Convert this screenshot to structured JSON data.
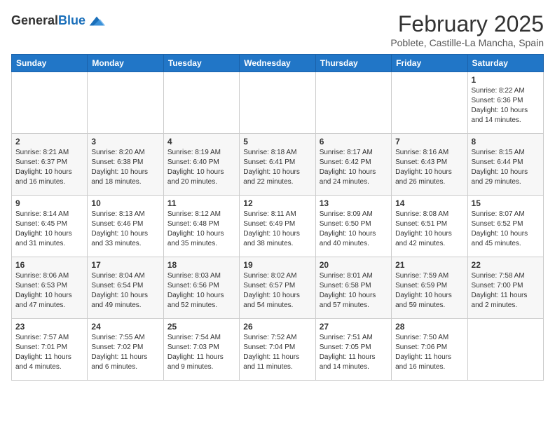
{
  "header": {
    "logo_general": "General",
    "logo_blue": "Blue",
    "title": "February 2025",
    "subtitle": "Poblete, Castille-La Mancha, Spain"
  },
  "weekdays": [
    "Sunday",
    "Monday",
    "Tuesday",
    "Wednesday",
    "Thursday",
    "Friday",
    "Saturday"
  ],
  "weeks": [
    [
      {
        "day": "",
        "info": ""
      },
      {
        "day": "",
        "info": ""
      },
      {
        "day": "",
        "info": ""
      },
      {
        "day": "",
        "info": ""
      },
      {
        "day": "",
        "info": ""
      },
      {
        "day": "",
        "info": ""
      },
      {
        "day": "1",
        "info": "Sunrise: 8:22 AM\nSunset: 6:36 PM\nDaylight: 10 hours and 14 minutes."
      }
    ],
    [
      {
        "day": "2",
        "info": "Sunrise: 8:21 AM\nSunset: 6:37 PM\nDaylight: 10 hours and 16 minutes."
      },
      {
        "day": "3",
        "info": "Sunrise: 8:20 AM\nSunset: 6:38 PM\nDaylight: 10 hours and 18 minutes."
      },
      {
        "day": "4",
        "info": "Sunrise: 8:19 AM\nSunset: 6:40 PM\nDaylight: 10 hours and 20 minutes."
      },
      {
        "day": "5",
        "info": "Sunrise: 8:18 AM\nSunset: 6:41 PM\nDaylight: 10 hours and 22 minutes."
      },
      {
        "day": "6",
        "info": "Sunrise: 8:17 AM\nSunset: 6:42 PM\nDaylight: 10 hours and 24 minutes."
      },
      {
        "day": "7",
        "info": "Sunrise: 8:16 AM\nSunset: 6:43 PM\nDaylight: 10 hours and 26 minutes."
      },
      {
        "day": "8",
        "info": "Sunrise: 8:15 AM\nSunset: 6:44 PM\nDaylight: 10 hours and 29 minutes."
      }
    ],
    [
      {
        "day": "9",
        "info": "Sunrise: 8:14 AM\nSunset: 6:45 PM\nDaylight: 10 hours and 31 minutes."
      },
      {
        "day": "10",
        "info": "Sunrise: 8:13 AM\nSunset: 6:46 PM\nDaylight: 10 hours and 33 minutes."
      },
      {
        "day": "11",
        "info": "Sunrise: 8:12 AM\nSunset: 6:48 PM\nDaylight: 10 hours and 35 minutes."
      },
      {
        "day": "12",
        "info": "Sunrise: 8:11 AM\nSunset: 6:49 PM\nDaylight: 10 hours and 38 minutes."
      },
      {
        "day": "13",
        "info": "Sunrise: 8:09 AM\nSunset: 6:50 PM\nDaylight: 10 hours and 40 minutes."
      },
      {
        "day": "14",
        "info": "Sunrise: 8:08 AM\nSunset: 6:51 PM\nDaylight: 10 hours and 42 minutes."
      },
      {
        "day": "15",
        "info": "Sunrise: 8:07 AM\nSunset: 6:52 PM\nDaylight: 10 hours and 45 minutes."
      }
    ],
    [
      {
        "day": "16",
        "info": "Sunrise: 8:06 AM\nSunset: 6:53 PM\nDaylight: 10 hours and 47 minutes."
      },
      {
        "day": "17",
        "info": "Sunrise: 8:04 AM\nSunset: 6:54 PM\nDaylight: 10 hours and 49 minutes."
      },
      {
        "day": "18",
        "info": "Sunrise: 8:03 AM\nSunset: 6:56 PM\nDaylight: 10 hours and 52 minutes."
      },
      {
        "day": "19",
        "info": "Sunrise: 8:02 AM\nSunset: 6:57 PM\nDaylight: 10 hours and 54 minutes."
      },
      {
        "day": "20",
        "info": "Sunrise: 8:01 AM\nSunset: 6:58 PM\nDaylight: 10 hours and 57 minutes."
      },
      {
        "day": "21",
        "info": "Sunrise: 7:59 AM\nSunset: 6:59 PM\nDaylight: 10 hours and 59 minutes."
      },
      {
        "day": "22",
        "info": "Sunrise: 7:58 AM\nSunset: 7:00 PM\nDaylight: 11 hours and 2 minutes."
      }
    ],
    [
      {
        "day": "23",
        "info": "Sunrise: 7:57 AM\nSunset: 7:01 PM\nDaylight: 11 hours and 4 minutes."
      },
      {
        "day": "24",
        "info": "Sunrise: 7:55 AM\nSunset: 7:02 PM\nDaylight: 11 hours and 6 minutes."
      },
      {
        "day": "25",
        "info": "Sunrise: 7:54 AM\nSunset: 7:03 PM\nDaylight: 11 hours and 9 minutes."
      },
      {
        "day": "26",
        "info": "Sunrise: 7:52 AM\nSunset: 7:04 PM\nDaylight: 11 hours and 11 minutes."
      },
      {
        "day": "27",
        "info": "Sunrise: 7:51 AM\nSunset: 7:05 PM\nDaylight: 11 hours and 14 minutes."
      },
      {
        "day": "28",
        "info": "Sunrise: 7:50 AM\nSunset: 7:06 PM\nDaylight: 11 hours and 16 minutes."
      },
      {
        "day": "",
        "info": ""
      }
    ]
  ]
}
